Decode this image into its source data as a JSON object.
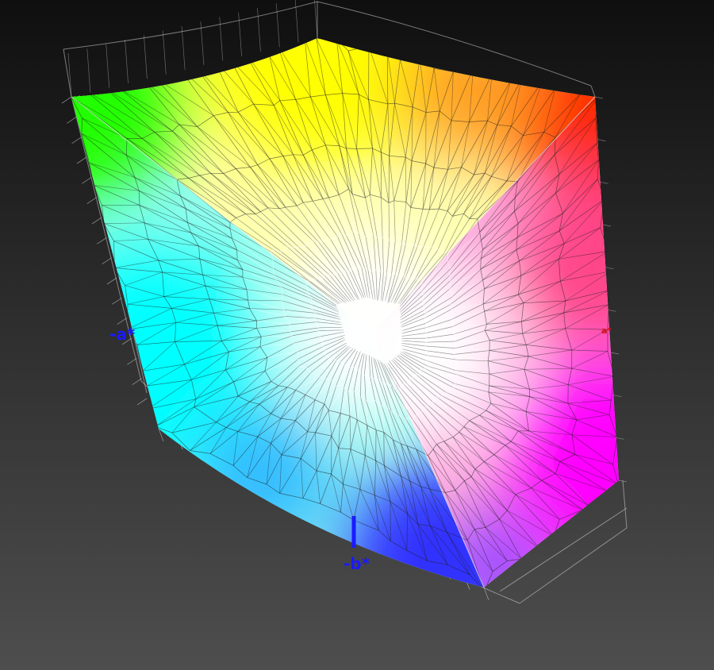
{
  "axes": {
    "neg_a": {
      "label": "-a*",
      "color": "#1a1aff"
    },
    "neg_b": {
      "label": "-b*",
      "color": "#1a1aff"
    },
    "pos_a": {
      "label": "a*",
      "color": "#d01010"
    }
  },
  "gamut": {
    "corner_colors": {
      "green": "#22ff00",
      "yellow": "#ffff00",
      "red": "#ff2a00",
      "cyan": "#00ffff",
      "white": "#ffffff",
      "magenta": "#ff00ff",
      "blue": "#3030ff"
    },
    "mesh_color": "#1e1e1e",
    "mesh_highlight_color": "#ffffff",
    "outline_color": "#cfcfcf"
  }
}
